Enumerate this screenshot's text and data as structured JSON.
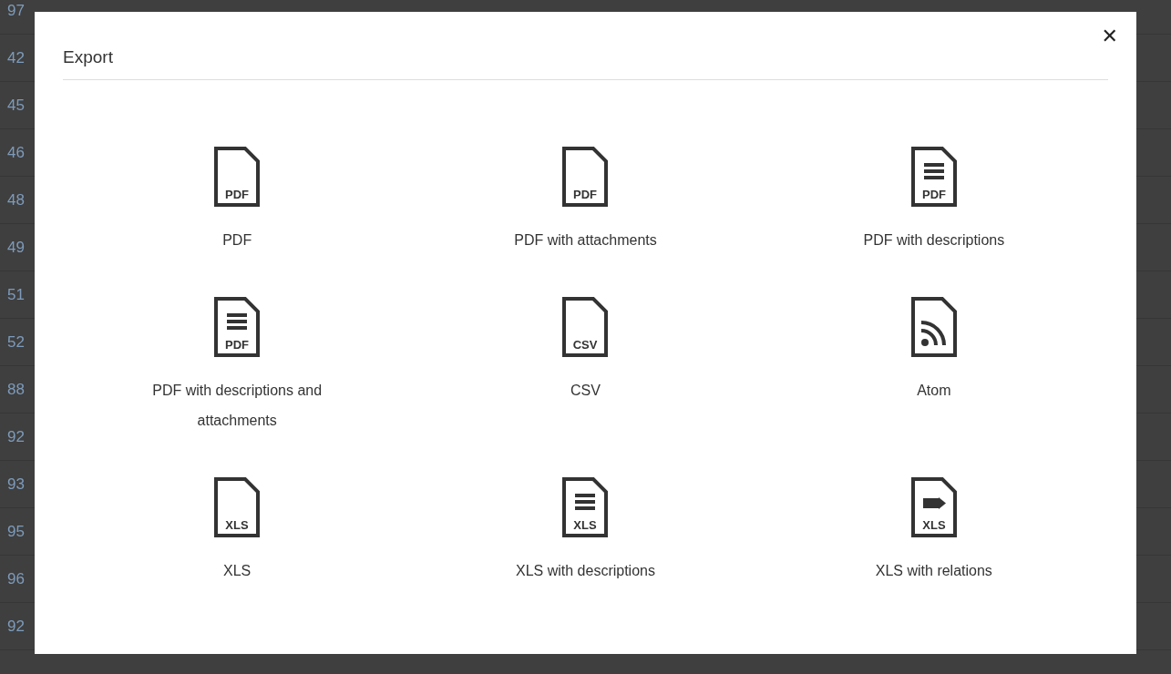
{
  "background": {
    "row_numbers": [
      "97",
      "42",
      "45",
      "46",
      "48",
      "49",
      "51",
      "52",
      "88",
      "92",
      "93",
      "95",
      "96",
      "92"
    ]
  },
  "dialog": {
    "title": "Export",
    "close": "✕",
    "options": [
      {
        "label": "PDF",
        "badge": "PDF",
        "kind": "plain"
      },
      {
        "label": "PDF with attachments",
        "badge": "PDF",
        "kind": "plain"
      },
      {
        "label": "PDF with descriptions",
        "badge": "PDF",
        "kind": "lines"
      },
      {
        "label": "PDF with descriptions and attachments",
        "badge": "PDF",
        "kind": "lines"
      },
      {
        "label": "CSV",
        "badge": "CSV",
        "kind": "plain"
      },
      {
        "label": "Atom",
        "kind": "feed"
      },
      {
        "label": "XLS",
        "badge": "XLS",
        "kind": "plain"
      },
      {
        "label": "XLS with descriptions",
        "badge": "XLS",
        "kind": "lines"
      },
      {
        "label": "XLS with relations",
        "badge": "XLS",
        "kind": "arrow"
      }
    ]
  }
}
